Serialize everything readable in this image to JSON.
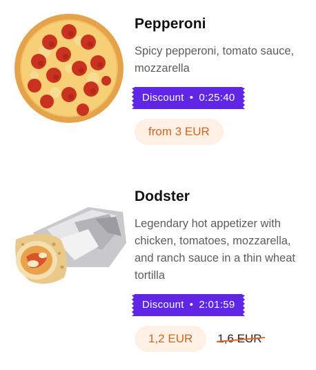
{
  "products": [
    {
      "name": "Pepperoni",
      "description": "Spicy pepperoni, tomato sauce, mozzarella",
      "discount_label": "Discount",
      "separator": "•",
      "timer": "0:25:40",
      "price": "from 3 EUR",
      "old_price": ""
    },
    {
      "name": "Dodster",
      "description": "Legendary hot appetizer with chicken, tomatoes, mozzarella, and ranch sauce in a thin wheat tortilla",
      "discount_label": "Discount",
      "separator": "•",
      "timer": "2:01:59",
      "price": "1,2 EUR",
      "old_price": "1,6 EUR"
    }
  ],
  "colors": {
    "discount_bg": "#5f26e6",
    "price_bg": "#fff0e6",
    "price_text": "#d3641f",
    "strike": "#e8661f"
  }
}
